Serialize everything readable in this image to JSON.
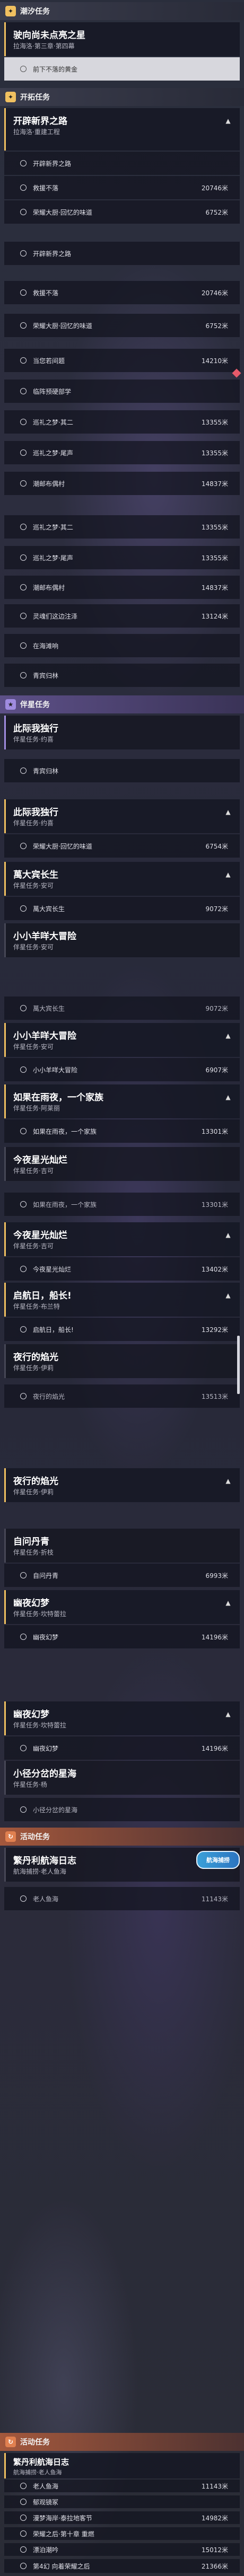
{
  "sections": {
    "tide": {
      "badge": "✦",
      "title": "潮汐任务"
    },
    "main": {
      "badge": "✦",
      "title": "开拓任务"
    },
    "companion1": {
      "badge": "★",
      "title": "伴星任务"
    },
    "companion2": {
      "badge": "★",
      "title": "伴星任务"
    },
    "event1": {
      "badge": "↻",
      "title": "活动任务"
    },
    "event2": {
      "badge": "↻",
      "title": "活动任务"
    }
  },
  "cards": {
    "c1": {
      "name": "驶向尚未点亮之星",
      "sub": "拉海洛·第三章·第四幕"
    },
    "c2": {
      "name": "开辟新界之路",
      "sub": "拉海洛·重建工程"
    },
    "c3": {
      "name": "此际我独行",
      "sub": "伴星任务·约喜"
    },
    "c4": {
      "name": "此际我独行",
      "sub": "伴星任务·约喜"
    },
    "c5": {
      "name": "萬大宾长生",
      "sub": "伴星任务·安可"
    },
    "c6": {
      "name": "小小羊咩大冒险",
      "sub": "伴星任务·安可"
    },
    "c7": {
      "name": "小小羊咩大冒险",
      "sub": "伴星任务·安可"
    },
    "c8": {
      "name": "如果在雨夜，一个家族",
      "sub": "伴星任务·阿莱丽"
    },
    "c9": {
      "name": "今夜星光灿烂",
      "sub": "伴星任务·吉可"
    },
    "c10": {
      "name": "今夜星光灿烂",
      "sub": "伴星任务·吉可"
    },
    "c11": {
      "name": "启航日，船长!",
      "sub": "伴星任务·布兰特"
    },
    "c12": {
      "name": "夜行的焰光",
      "sub": "伴星任务·伊莉"
    },
    "c13": {
      "name": "夜行的焰光",
      "sub": "伴星任务·伊莉"
    },
    "c14": {
      "name": "自问丹青",
      "sub": "伴星任务·折枝"
    },
    "c15": {
      "name": "幽夜幻梦",
      "sub": "伴星任务·坎特蕾拉"
    },
    "c16": {
      "name": "幽夜幻梦",
      "sub": "伴星任务·坎特蕾拉"
    },
    "c17": {
      "name": "小径分岔的星海",
      "sub": "伴星任务·杨"
    },
    "c18": {
      "name": "繁丹利航海日志",
      "sub": "航海捕捞·老人鱼海"
    },
    "c19": {
      "name": "繁丹利航海日志",
      "sub": "航海捕捞·老人鱼海"
    }
  },
  "steps": {
    "s1": {
      "label": "前下不落的黄金",
      "dist": ""
    },
    "s2": {
      "label": "开辟新界之路",
      "dist": ""
    },
    "s3": {
      "label": "救援不落",
      "dist": "20746米"
    },
    "s4": {
      "label": "荣耀大厨·回忆的味道",
      "dist": "6752米"
    },
    "s5": {
      "label": "开辟新界之路",
      "dist": ""
    },
    "s6": {
      "label": "救援不落",
      "dist": "20746米"
    },
    "s7": {
      "label": "荣耀大厨·回忆的味道",
      "dist": "6752米"
    },
    "s8": {
      "label": "当您若间题",
      "dist": "14210米"
    },
    "s9": {
      "label": "临阵预硬部学",
      "dist": ""
    },
    "s10": {
      "label": "巡礼之梦·其二",
      "dist": "13355米"
    },
    "s11": {
      "label": "巡礼之梦·尾声",
      "dist": "13355米"
    },
    "s12": {
      "label": "潮邮布偶村",
      "dist": "14837米"
    },
    "s13": {
      "label": "巡礼之梦·其二",
      "dist": "13355米"
    },
    "s14": {
      "label": "巡礼之梦·尾声",
      "dist": "13355米"
    },
    "s15": {
      "label": "潮邮布偶村",
      "dist": "14837米"
    },
    "s16": {
      "label": "灵魂们这边注泽",
      "dist": "13124米"
    },
    "s17": {
      "label": "在海滩响",
      "dist": ""
    },
    "s18": {
      "label": "青宾归林",
      "dist": ""
    },
    "s19": {
      "label": "青宾归林",
      "dist": ""
    },
    "s20": {
      "label": "荣耀大厨·回忆的味道",
      "dist": "6754米"
    },
    "s21": {
      "label": "萬大宾长生",
      "dist": "9072米"
    },
    "s22": {
      "label": "萬大宾长生",
      "dist": "9072米"
    },
    "s23": {
      "label": "小小羊咩大冒险",
      "dist": "6907米"
    },
    "s24": {
      "label": "如果在雨夜，一个家族",
      "dist": "13301米"
    },
    "s25": {
      "label": "如果在雨夜，一个家族",
      "dist": "13301米"
    },
    "s26": {
      "label": "今夜星光灿烂",
      "dist": "13402米"
    },
    "s27": {
      "label": "启航日，船长!",
      "dist": "13292米"
    },
    "s28": {
      "label": "夜行的焰光",
      "dist": "13513米"
    },
    "s29": {
      "label": "自问丹青",
      "dist": "6993米"
    },
    "s30": {
      "label": "幽夜幻梦",
      "dist": "14196米"
    },
    "s31": {
      "label": "幽夜幻梦",
      "dist": "14196米"
    },
    "s32": {
      "label": "小径分岔的星海",
      "dist": ""
    },
    "s33": {
      "label": "老人鱼海",
      "dist": "11143米"
    },
    "s34": {
      "label": "老人鱼海",
      "dist": "11143米"
    },
    "s35": {
      "label": "郁观镜冢",
      "dist": ""
    },
    "s36": {
      "label": "漫梦海岸·泰拉地客节",
      "dist": "14982米"
    },
    "s37": {
      "label": "荣耀之后·第十章 重燃",
      "dist": ""
    },
    "s38": {
      "label": "漂泊潮吟",
      "dist": "15012米"
    },
    "s39": {
      "label": "第4幻 向着荣耀之后",
      "dist": "21366米"
    }
  },
  "navlogo": {
    "label": "航海捕捞"
  },
  "colors": {
    "accent_gold": "#f0c060",
    "accent_purple": "#a08ce0",
    "accent_orange": "#e08050",
    "nav_blue": "#3aa0d8"
  }
}
